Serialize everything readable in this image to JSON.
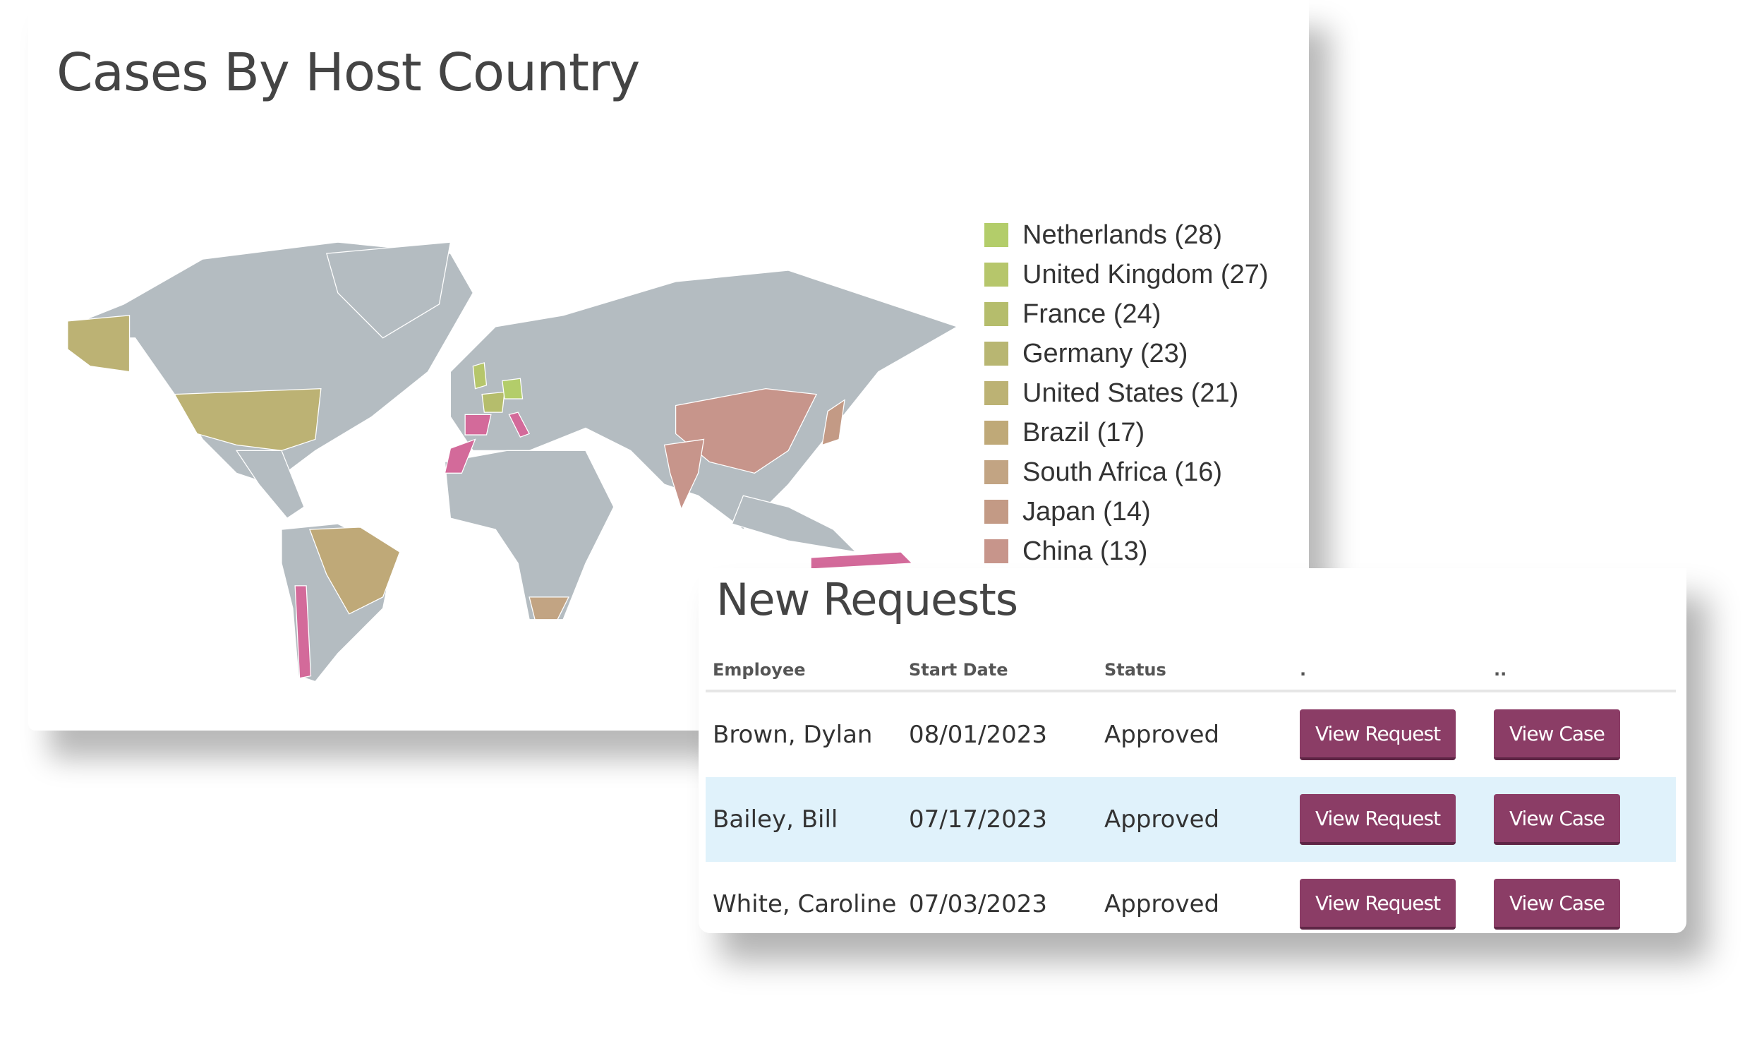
{
  "map_panel": {
    "title": "Cases By Host Country",
    "legend": [
      {
        "label": "Netherlands (28)",
        "color": "#b3cd6a"
      },
      {
        "label": "United Kingdom (27)",
        "color": "#b6c66b"
      },
      {
        "label": "France (24)",
        "color": "#b5bd6c"
      },
      {
        "label": "Germany (23)",
        "color": "#b8b672"
      },
      {
        "label": "United States (21)",
        "color": "#bcb274"
      },
      {
        "label": "Brazil (17)",
        "color": "#bfa978"
      },
      {
        "label": "South Africa (16)",
        "color": "#c2a483"
      },
      {
        "label": "Japan (14)",
        "color": "#c39a85"
      },
      {
        "label": "China (13)",
        "color": "#c7958b"
      }
    ],
    "colors": {
      "land": "#b4bcc1",
      "highlight_pink": "#d36a9a"
    }
  },
  "requests_panel": {
    "title": "New Requests",
    "columns": [
      "Employee",
      "Start Date",
      "Status",
      ".",
      ".."
    ],
    "rows": [
      {
        "employee": "Brown, Dylan",
        "start_date": "08/01/2023",
        "status": "Approved",
        "view_request": "View Request",
        "view_case": "View Case"
      },
      {
        "employee": "Bailey, Bill",
        "start_date": "07/17/2023",
        "status": "Approved",
        "view_request": "View Request",
        "view_case": "View Case"
      },
      {
        "employee": "White, Caroline",
        "start_date": "07/03/2023",
        "status": "Approved",
        "view_request": "View Request",
        "view_case": "View Case"
      }
    ],
    "colors": {
      "button": "#8b3d66",
      "row_highlight": "#e0f2fb"
    }
  }
}
